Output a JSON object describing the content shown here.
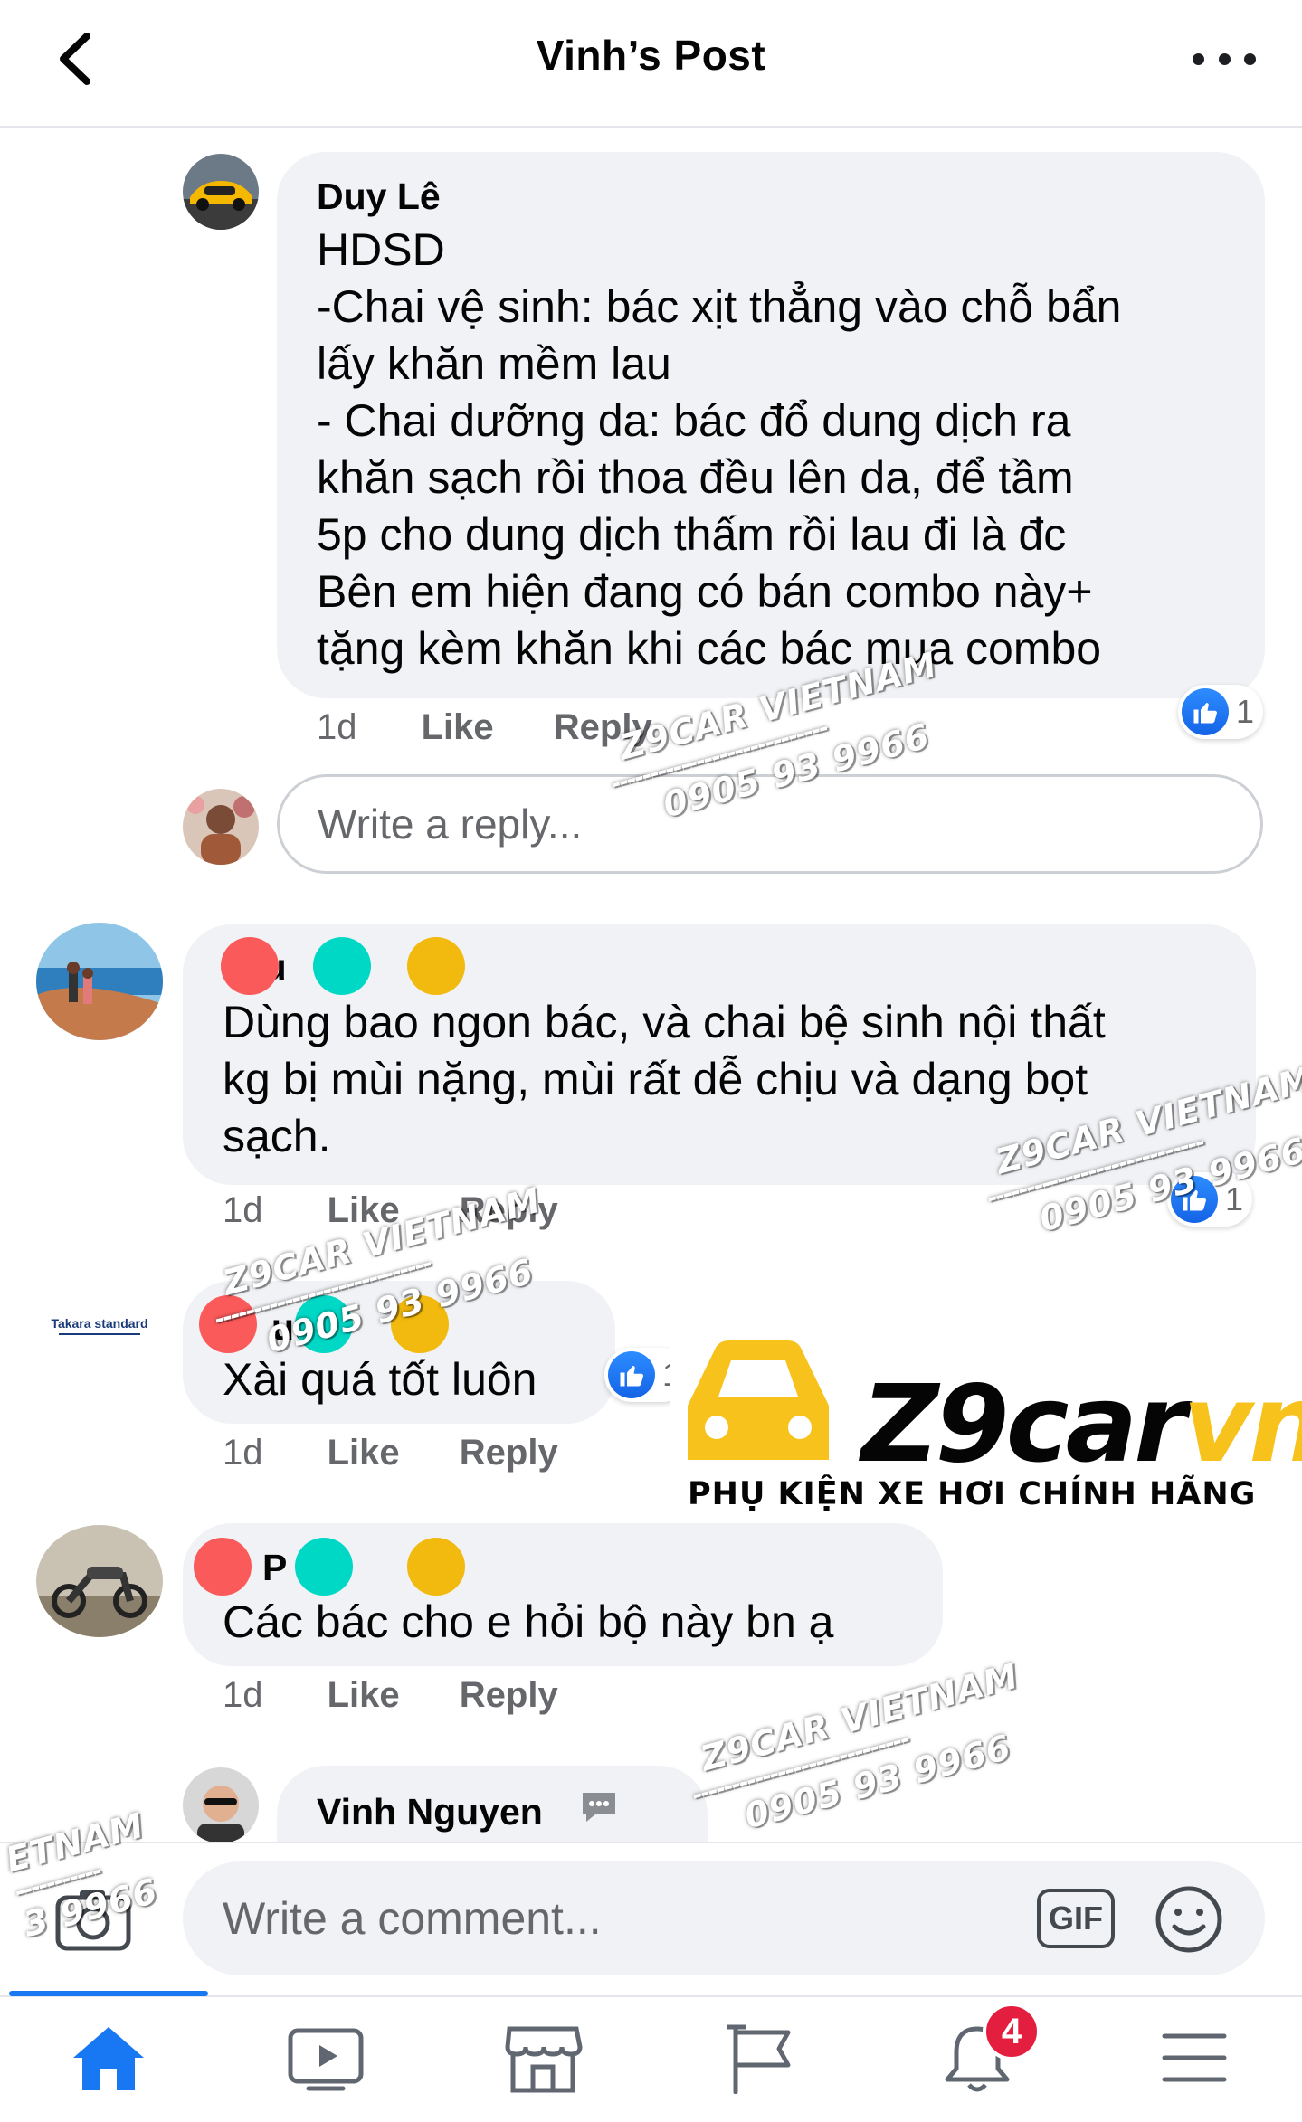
{
  "header": {
    "title": "Vinh’s Post"
  },
  "comments": [
    {
      "author": "Duy Lê",
      "lines": [
        "HDSD",
        "-Chai vệ sinh: bác xịt thẳng vào chỗ bẩn",
        "lấy khăn mềm lau",
        "- Chai dưỡng da: bác đổ dung dịch ra",
        "khăn sạch rồi thoa đều lên da, để tầm",
        "5p cho dung dịch thấm rồi lau đi là đc",
        "Bên em hiện đang có bán combo này+",
        "tặng kèm khăn khi các bác mua combo"
      ],
      "time": "1d",
      "like": "Like",
      "reply": "Reply",
      "reactions": "1"
    },
    {
      "author_partial": "vi u",
      "lines": [
        "Dùng bao ngon bác, và chai bệ sinh nội thất",
        "kg bị mùi nặng, mùi rất dễ chịu và dạng bọt",
        "sạch."
      ],
      "time": "1d",
      "like": "Like",
      "reply": "Reply",
      "reactions": "1"
    },
    {
      "author_partial": "uu",
      "avatar_text": "Takara standard",
      "lines": [
        "Xài quá tốt luôn"
      ],
      "time": "1d",
      "like": "Like",
      "reply": "Reply",
      "reactions": "1"
    },
    {
      "author_partial": "P m",
      "lines": [
        "Các bác cho e hỏi bộ này bn ạ"
      ],
      "time": "1d",
      "like": "Like",
      "reply": "Reply"
    },
    {
      "author": "Vinh Nguyen"
    }
  ],
  "reply_box": {
    "placeholder": "Write a reply..."
  },
  "composer": {
    "placeholder": "Write a comment...",
    "gif_label": "GIF"
  },
  "tabbar": {
    "notification_count": "4"
  },
  "watermark": {
    "line1": "Z9CAR VIETNAM",
    "line2": "0905 93 9966",
    "line1_cut": "ETNAM",
    "line2_cut": "3 9966"
  },
  "logo": {
    "name_a": "Z9car",
    "name_b": "vn",
    "tagline": "PHỤ KIỆN XE HƠI CHÍNH HÃNG"
  },
  "colors": {
    "accent": "#1877f2",
    "bubble": "#f0f2f5",
    "logo_yellow": "#f7c21b",
    "badge": "#e41e3f",
    "redact_red": "#fb5a5a",
    "redact_teal": "#00d8c6",
    "redact_yellow": "#f2b90e"
  },
  "icons": [
    "back-chevron-icon",
    "more-dots-icon",
    "like-icon",
    "camera-icon",
    "gif-icon",
    "emoji-icon",
    "home-icon",
    "video-icon",
    "marketplace-icon",
    "flag-icon",
    "bell-icon",
    "menu-icon"
  ]
}
